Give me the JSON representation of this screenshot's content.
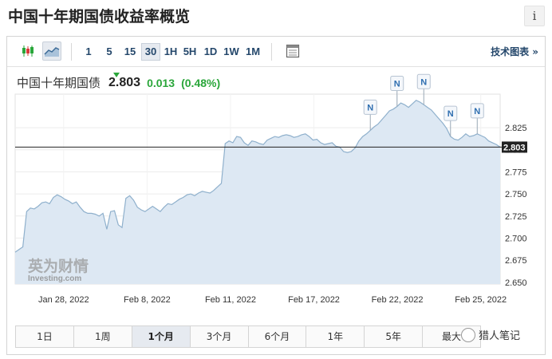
{
  "page": {
    "title": "中国十年期国债收益率概览",
    "info_label": "i"
  },
  "toolbar": {
    "timeframes": [
      "1",
      "5",
      "15",
      "30",
      "1H",
      "5H",
      "1D",
      "1W",
      "1M"
    ],
    "active_timeframe": "30",
    "tech_link": "技术图表 »"
  },
  "quote": {
    "name": "中国十年期国债",
    "price": "2.803",
    "change": "0.013",
    "change_pct": "(0.48%)",
    "direction_color": "#2aa63a"
  },
  "range_buttons": [
    "1日",
    "1周",
    "1个月",
    "3个月",
    "6个月",
    "1年",
    "5年",
    "最大"
  ],
  "active_range": "1个月",
  "logo": {
    "cn": "英为财情",
    "en": "Investing.com"
  },
  "watermark": "猎人笔记",
  "chart_data": {
    "type": "area",
    "series": [
      {
        "values": [
          2.684,
          2.687,
          2.69,
          2.73,
          2.734,
          2.733,
          2.736,
          2.74,
          2.741,
          2.739,
          2.746,
          2.749,
          2.747,
          2.744,
          2.742,
          2.739,
          2.741,
          2.735,
          2.73,
          2.728,
          2.728,
          2.727,
          2.725,
          2.728,
          2.71,
          2.73,
          2.731,
          2.715,
          2.712,
          2.745,
          2.748,
          2.743,
          2.735,
          2.732,
          2.73,
          2.733,
          2.736,
          2.733,
          2.73,
          2.735,
          2.739,
          2.738,
          2.741,
          2.744,
          2.746,
          2.749,
          2.75,
          2.748,
          2.751,
          2.753,
          2.752,
          2.751,
          2.754,
          2.758,
          2.762,
          2.807,
          2.81,
          2.808,
          2.815,
          2.814,
          2.808,
          2.805,
          2.81,
          2.809,
          2.807,
          2.806,
          2.811,
          2.813,
          2.815,
          2.814,
          2.816,
          2.817,
          2.816,
          2.814,
          2.815,
          2.817,
          2.818,
          2.815,
          2.811,
          2.812,
          2.808,
          2.806,
          2.807,
          2.808,
          2.804,
          2.803,
          2.798,
          2.797,
          2.798,
          2.802,
          2.81,
          2.815,
          2.818,
          2.822,
          2.826,
          2.829,
          2.834,
          2.839,
          2.844,
          2.846,
          2.849,
          2.853,
          2.851,
          2.848,
          2.852,
          2.856,
          2.854,
          2.851,
          2.848,
          2.845,
          2.84,
          2.835,
          2.83,
          2.824,
          2.815,
          2.812,
          2.811,
          2.814,
          2.818,
          2.815,
          2.816,
          2.818,
          2.816,
          2.814,
          2.81,
          2.808,
          2.806,
          2.803
        ]
      }
    ],
    "x_tick_labels": [
      "Jan 28, 2022",
      "Feb 8, 2022",
      "Feb 11, 2022",
      "Feb 17, 2022",
      "Feb 22, 2022",
      "Feb 25, 2022"
    ],
    "y_tick_labels": [
      "2.825",
      "2.800",
      "2.775",
      "2.750",
      "2.725",
      "2.700",
      "2.675",
      "2.650"
    ],
    "y_ticks": [
      2.825,
      2.8,
      2.775,
      2.75,
      2.725,
      2.7,
      2.675,
      2.65
    ],
    "ylim": [
      2.648,
      2.863
    ],
    "last_value": 2.803,
    "last_label": "2.803",
    "news_markers": [
      "N",
      "N",
      "N",
      "N",
      "N"
    ],
    "fill_color": "#dde8f3",
    "line_color": "#8fb0cc",
    "grid": true
  }
}
